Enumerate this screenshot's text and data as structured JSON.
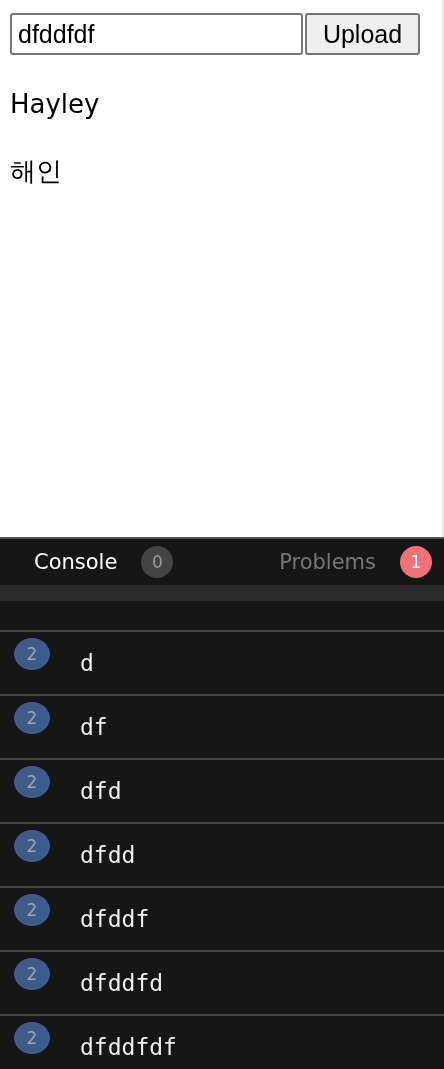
{
  "upload_form": {
    "value": "dfddfdf",
    "button": "Upload"
  },
  "names": [
    "Hayley",
    "해인"
  ],
  "console_panel": {
    "tabs": [
      {
        "label": "Console",
        "count": "0",
        "selected": true,
        "kind": "neutral"
      },
      {
        "label": "Problems",
        "count": "1",
        "selected": false,
        "kind": "error"
      }
    ],
    "logs": [
      {
        "count": "2",
        "message": "d"
      },
      {
        "count": "2",
        "message": "df"
      },
      {
        "count": "2",
        "message": "dfd"
      },
      {
        "count": "2",
        "message": "dfdd"
      },
      {
        "count": "2",
        "message": "dfddf"
      },
      {
        "count": "2",
        "message": "dfddfd"
      },
      {
        "count": "2",
        "message": "dfddfdf"
      }
    ]
  }
}
